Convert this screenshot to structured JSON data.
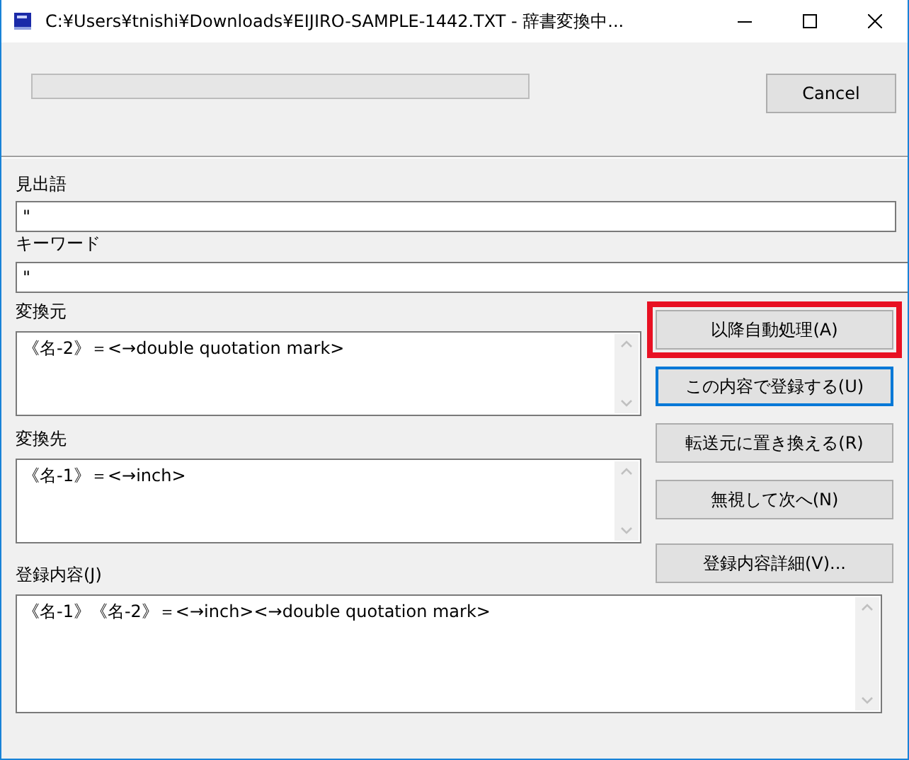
{
  "window": {
    "title": "C:¥Users¥tnishi¥Downloads¥EIJIRO-SAMPLE-1442.TXT - 辞書変換中..."
  },
  "progress": {
    "level": 0
  },
  "cancel_button": {
    "label": "Cancel"
  },
  "headword": {
    "label": "見出語",
    "value": "\""
  },
  "keyword": {
    "label": "キーワード",
    "value": "\""
  },
  "source": {
    "label": "変換元",
    "value": "《名-2》＝<→double quotation mark>"
  },
  "target": {
    "label": "変換先",
    "value": "《名-1》＝<→inch>"
  },
  "entry": {
    "label": "登録内容(J)",
    "value": "《名-1》《名-2》＝<→inch><→double quotation mark>"
  },
  "buttons": [
    {
      "label": "以降自動処理(A)",
      "highlighted": true,
      "focused": false
    },
    {
      "label": "この内容で登録する(U)",
      "highlighted": false,
      "focused": true
    },
    {
      "label": "転送元に置き換える(R)",
      "highlighted": false,
      "focused": false
    },
    {
      "label": "無視して次へ(N)",
      "highlighted": false,
      "focused": false
    },
    {
      "label": "登録内容詳細(V)...",
      "highlighted": false,
      "focused": false
    }
  ]
}
